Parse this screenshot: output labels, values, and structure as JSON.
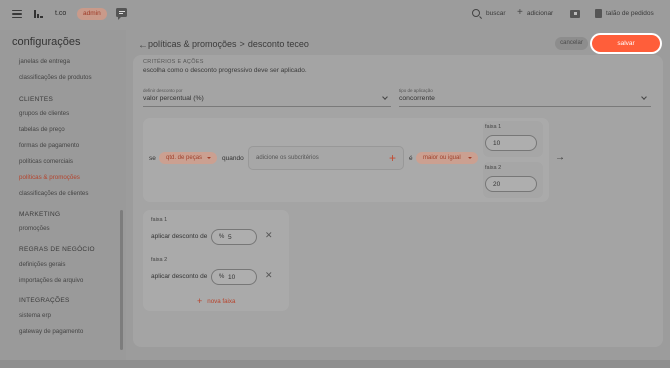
{
  "topbar": {
    "store_name": "t.co",
    "admin_badge": "admin",
    "search_label": "buscar",
    "add_label": "adicionar",
    "orders_label": "talão de pedidos"
  },
  "sidebar": {
    "title": "configurações",
    "items_top": [
      "janelas de entrega",
      "classificações de produtos"
    ],
    "sections": [
      {
        "title": "CLIENTES",
        "items": [
          "grupos de clientes",
          "tabelas de preço",
          "formas de pagamento",
          "políticas comerciais",
          "políticas & promoções",
          "classificações de clientes"
        ]
      },
      {
        "title": "MARKETING",
        "items": [
          "promoções"
        ]
      },
      {
        "title": "REGRAS DE NEGÓCIO",
        "items": [
          "definições gerais",
          "importações de arquivo"
        ]
      },
      {
        "title": "INTEGRAÇÕES",
        "items": [
          "sistema erp",
          "gateway de pagamento"
        ]
      }
    ]
  },
  "main": {
    "breadcrumb_parent": "políticas & promoções",
    "breadcrumb_sep": ">",
    "breadcrumb_current": "desconto teceo",
    "cancel_label": "cancelar",
    "save_label": "salvar",
    "section_caption": "CRITÉRIOS E AÇÕES",
    "section_desc": "escolha como o desconto progressivo deve ser aplicado.",
    "define_label": "definir desconto por",
    "define_value": "valor percentual (%)",
    "apply_type_label": "tipo de aplicação",
    "apply_type_value": "concorrente"
  },
  "condition": {
    "se": "se",
    "quantity_pill": "qtd. de peças",
    "quando": "quando",
    "sub_placeholder": "adicione os subcritérios",
    "e": "é",
    "operator_pill": "maior ou igual",
    "tiers": [
      {
        "label": "faixa 1",
        "value": "10"
      },
      {
        "label": "faixa 2",
        "value": "20"
      }
    ]
  },
  "discounts": {
    "apply_label": "aplicar desconto de",
    "prefix": "%",
    "tiers": [
      {
        "label": "faixa 1",
        "value": "5"
      },
      {
        "label": "faixa 2",
        "value": "10"
      }
    ],
    "new_tier_label": "nova faixa"
  }
}
